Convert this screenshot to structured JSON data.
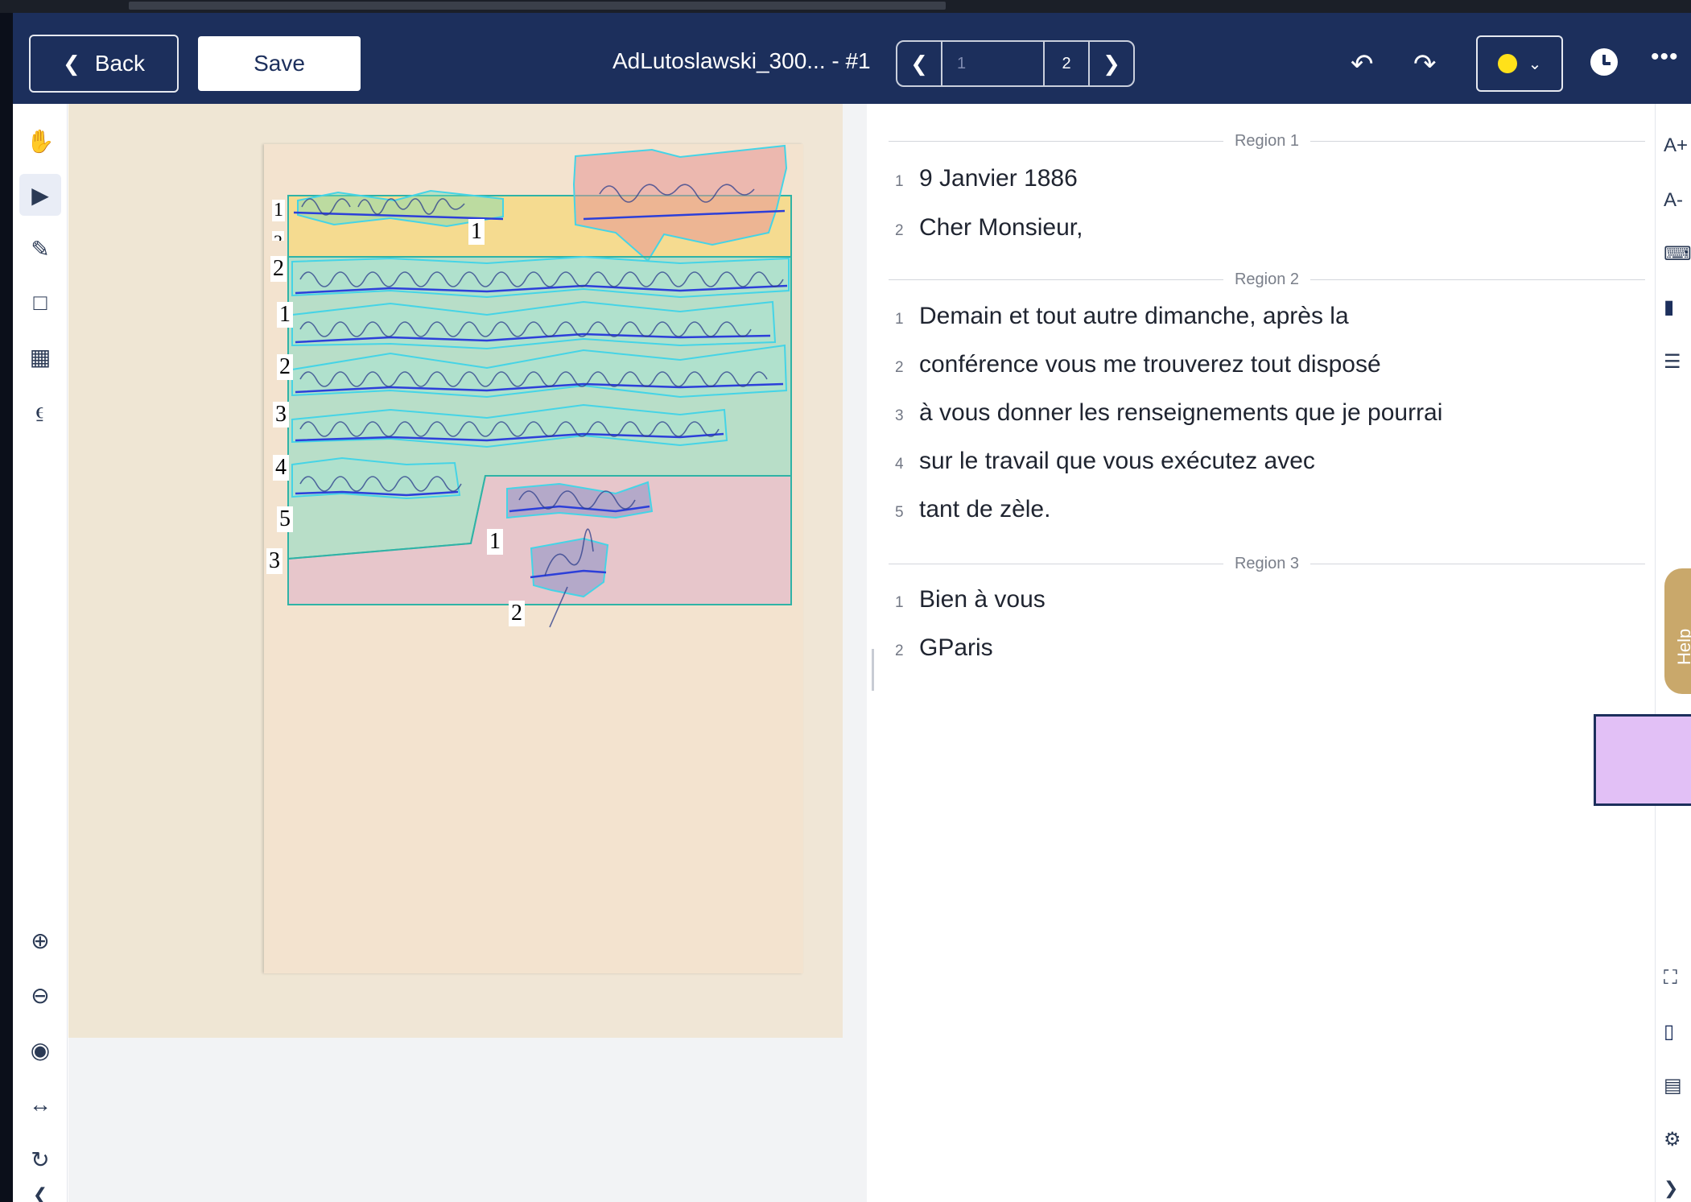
{
  "header": {
    "back_label": "Back",
    "save_label": "Save",
    "doc_title": "AdLutoslawski_300... - #1",
    "pager": {
      "current": "1",
      "total": "2"
    }
  },
  "icons": {
    "back": "chevron-left-icon",
    "undo": "undo-icon",
    "redo": "redo-icon",
    "color": "color-dot-icon",
    "clock": "clock-icon",
    "more": "more-icon"
  },
  "colors": {
    "header_bg": "#1c2f5c",
    "brush_color": "#ffe11a",
    "region_teal": "#2fb3a6",
    "baseline_blue": "#2c3fd9",
    "polygon_cyan": "#45d4e6",
    "accent_purple": "#e2c0f6"
  },
  "canvas_labels": {
    "r1": "1",
    "r1_line1": "1",
    "r1_line2": "2",
    "r2": "2",
    "r2_l1": "1",
    "r2_l2": "2",
    "r2_l3": "3",
    "r2_l4": "4",
    "r2_l5": "5",
    "r3": "3",
    "r3_l1": "1",
    "r3_l2": "2"
  },
  "transcription": {
    "regions": [
      {
        "label": "Region 1",
        "lines": [
          {
            "num": "1",
            "text": "9 Janvier 1886"
          },
          {
            "num": "2",
            "text": "Cher Monsieur,"
          }
        ]
      },
      {
        "label": "Region 2",
        "lines": [
          {
            "num": "1",
            "text": "Demain et tout autre dimanche, après la"
          },
          {
            "num": "2",
            "text": "conférence vous me trouverez tout disposé"
          },
          {
            "num": "3",
            "text": "à vous donner les renseignements que je pourrai"
          },
          {
            "num": "4",
            "text": "sur le travail que vous exécutez avec"
          },
          {
            "num": "5",
            "text": "tant de zèle."
          }
        ]
      },
      {
        "label": "Region 3",
        "lines": [
          {
            "num": "1",
            "text": "Bien à vous"
          },
          {
            "num": "2",
            "text": "GParis"
          }
        ]
      }
    ]
  },
  "sidebar": {
    "font_increase": "A+",
    "font_decrease": "A-",
    "help_label": "Help"
  }
}
